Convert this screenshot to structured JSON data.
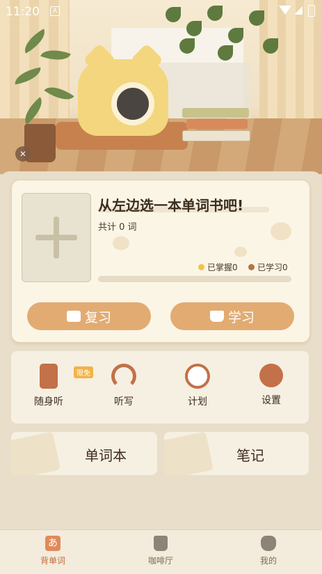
{
  "status_bar": {
    "time": "11:20",
    "notification_icon": "A"
  },
  "hero": {
    "mute_icon": "sound-off-icon"
  },
  "book_card": {
    "title": "从左边选一本单词书吧!",
    "word_count": "共计 0 词",
    "legend": {
      "mastered": "已掌握0",
      "learned": "已学习0"
    },
    "progress": 0,
    "buttons": {
      "review": "复习",
      "learn": "学习"
    }
  },
  "features": [
    {
      "label": "随身听",
      "icon": "music-player-icon",
      "tag": "限免"
    },
    {
      "label": "听写",
      "icon": "headphones-icon"
    },
    {
      "label": "计划",
      "icon": "alarm-clock-icon"
    },
    {
      "label": "设置",
      "icon": "gear-icon"
    }
  ],
  "cards": {
    "wordbook": "单词本",
    "notes": "笔记"
  },
  "nav": [
    {
      "label": "背单词",
      "icon": "あ",
      "active": true
    },
    {
      "label": "咖啡厅",
      "icon": "coffee-cup-icon",
      "active": false
    },
    {
      "label": "我的",
      "icon": "cat-face-icon",
      "active": false
    }
  ],
  "colors": {
    "accent": "#e2ab72",
    "mastered_dot": "#f2c34b",
    "learned_dot": "#b07840",
    "nav_active": "#c06a3e"
  }
}
